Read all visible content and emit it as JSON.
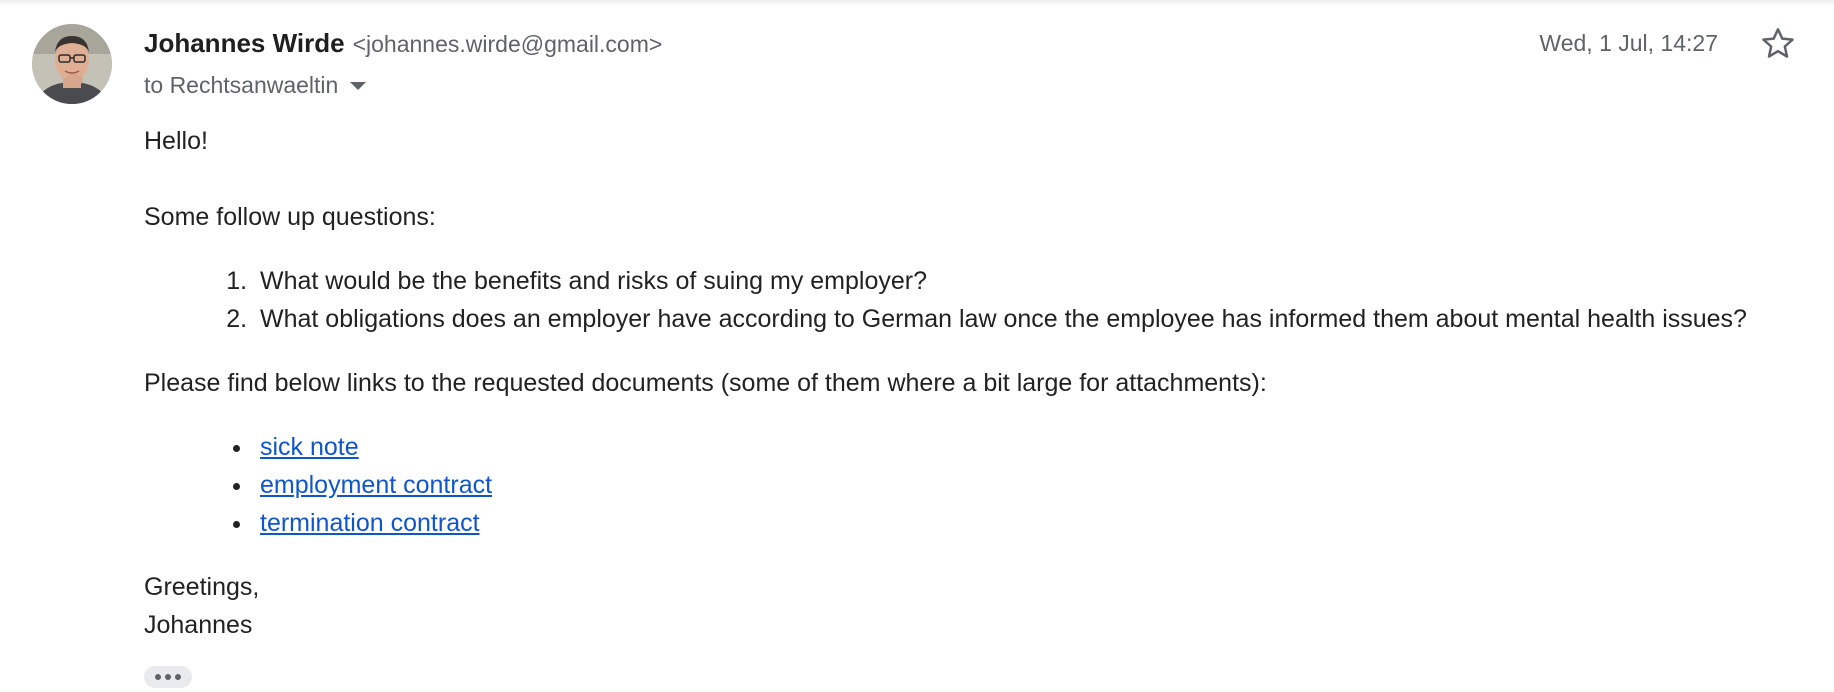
{
  "email": {
    "sender": {
      "name": "Johannes Wirde",
      "email": "<johannes.wirde@gmail.com>"
    },
    "recipient_line": "to Rechtsanwaeltin",
    "date": "Wed, 1 Jul, 14:27",
    "body": {
      "greeting": "Hello!",
      "intro": "Some follow up questions:",
      "questions": [
        "What would be the benefits and risks of suing my employer?",
        "What obligations does an employer have according to German law once the employee has informed them about mental health issues?"
      ],
      "links_intro": "Please find below links to the requested documents (some of them where a bit large for attachments):",
      "links": [
        "sick note",
        "employment contract",
        "termination contract"
      ],
      "closing": "Greetings,",
      "signature": "Johannes"
    }
  },
  "icons": {
    "star": "star-icon",
    "dropdown": "caret-down-icon",
    "more": "more-horiz-icon"
  },
  "colors": {
    "link": "#1155cc",
    "secondary_text": "#5f6368",
    "primary_text": "#222222"
  }
}
